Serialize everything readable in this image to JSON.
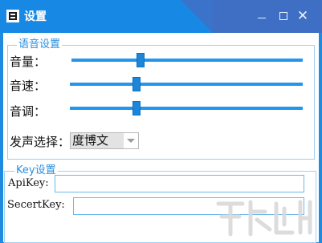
{
  "window": {
    "title": "设置"
  },
  "voice_group": {
    "title": "语音设置",
    "volume": {
      "label": "音量：",
      "value_percent": 29
    },
    "speed": {
      "label": "音速：",
      "value_percent": 28
    },
    "pitch": {
      "label": "音调：",
      "value_percent": 28
    },
    "speaker": {
      "label": "发声选择：",
      "selected": "度博文"
    }
  },
  "key_group": {
    "title": "Key设置",
    "api_key": {
      "label": "ApiKey:",
      "value": ""
    },
    "secret_key": {
      "label": "SecertKey:",
      "value": ""
    }
  },
  "colors": {
    "titlebar": "#1789e4",
    "accent": "#2196ec",
    "border": "#9ed0f4"
  }
}
